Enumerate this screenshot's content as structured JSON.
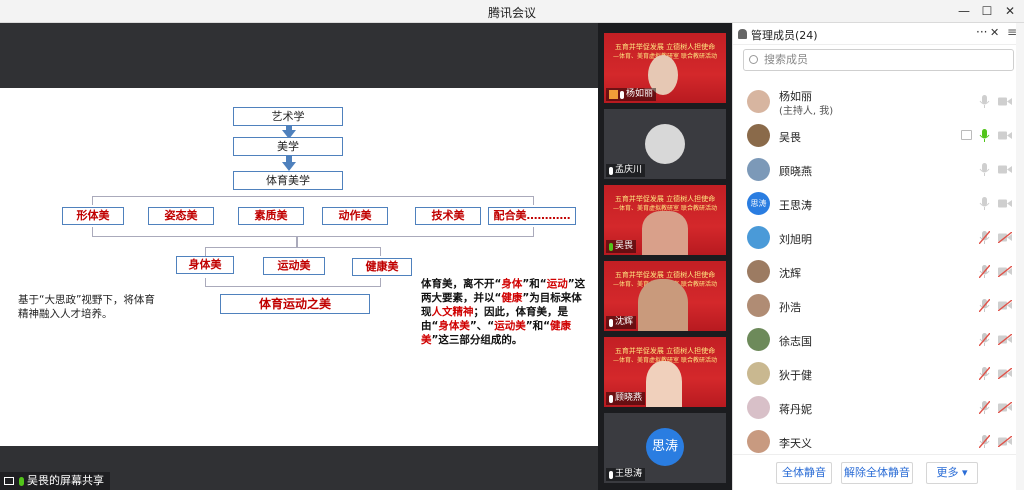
{
  "window": {
    "title": "腾讯会议"
  },
  "slide": {
    "top_box_1": "艺术学",
    "top_box_2": "美学",
    "top_box_3": "体育美学",
    "row1": [
      "形体美",
      "姿态美",
      "素质美",
      "动作美",
      "技术美",
      "配合美…………"
    ],
    "row2": [
      "身体美",
      "运动美",
      "健康美"
    ],
    "bottom_box": "体育运动之美",
    "left_note": "基于“大思政”视野下，将体育精神融入人才培养。",
    "right_note": {
      "p1": "体育美，离不开“",
      "r1": "身体",
      "p2": "”和“",
      "r2": "运动",
      "p3": "”这两大要素，并以“",
      "r3": "健康",
      "p4": "”为目标来体现",
      "r4": "人文精神",
      "p5": "；因此，体育美，是由“",
      "r5": "身体美",
      "p6": "”、“",
      "r6": "运动美",
      "p7": "”和“",
      "r7": "健康美",
      "p8": "”这三部分组成的。"
    }
  },
  "share_status": "吴畏的屏幕共享",
  "banner": {
    "line1": "五育并举促发展  立德树人担使命",
    "line2": "—体育、美育虚拟教研室  联合教研活动"
  },
  "video_tiles": [
    {
      "name": "杨如丽",
      "type": "banner"
    },
    {
      "name": "孟庆川",
      "type": "gray"
    },
    {
      "name": "吴畏",
      "type": "banner"
    },
    {
      "name": "沈辉",
      "type": "banner"
    },
    {
      "name": "顾晓燕",
      "type": "banner"
    },
    {
      "name": "王思涛",
      "type": "blue",
      "avatar_text": "思涛"
    }
  ],
  "panel": {
    "title": "管理成员(24)",
    "search_placeholder": "搜索成员",
    "members": [
      {
        "name": "杨如丽",
        "sub": "(主持人, 我)",
        "mic": "on",
        "cam": "off",
        "avatar_color": "#d7b5a0"
      },
      {
        "name": "吴畏",
        "sub": "",
        "mic": "active",
        "cam": "off",
        "screen": true,
        "avatar_color": "#8a6a4a"
      },
      {
        "name": "顾晓燕",
        "sub": "",
        "mic": "on",
        "cam": "off",
        "avatar_color": "#7c99b8"
      },
      {
        "name": "王思涛",
        "sub": "",
        "mic": "on",
        "cam": "off",
        "avatar_text": "思涛",
        "avatar_color": "#2a7de1"
      },
      {
        "name": "刘旭明",
        "sub": "",
        "mic": "muted",
        "cam": "muted",
        "avatar_color": "#4a9ad8"
      },
      {
        "name": "沈辉",
        "sub": "",
        "mic": "muted",
        "cam": "muted",
        "avatar_color": "#9c7b62"
      },
      {
        "name": "孙浩",
        "sub": "",
        "mic": "muted",
        "cam": "muted",
        "avatar_color": "#b08c74"
      },
      {
        "name": "徐志国",
        "sub": "",
        "mic": "muted",
        "cam": "muted",
        "avatar_color": "#6d8a5a"
      },
      {
        "name": "狄于健",
        "sub": "",
        "mic": "muted",
        "cam": "muted",
        "avatar_color": "#c9b890"
      },
      {
        "name": "蒋丹妮",
        "sub": "",
        "mic": "muted",
        "cam": "muted",
        "avatar_color": "#d8c0c8"
      },
      {
        "name": "李天义",
        "sub": "",
        "mic": "muted",
        "cam": "muted",
        "avatar_color": "#c89a80"
      }
    ],
    "buttons": {
      "mute_all": "全体静音",
      "unmute_all": "解除全体静音",
      "more": "更多 ▾"
    }
  },
  "colors": {
    "accent": "#2a6cd6",
    "mic_on": "#52c41a",
    "muted": "#e0534a"
  }
}
